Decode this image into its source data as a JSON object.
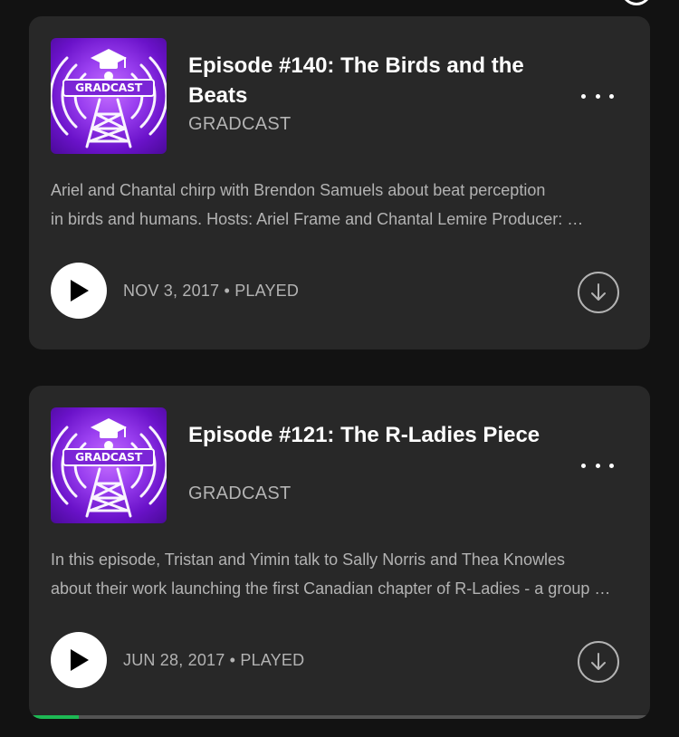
{
  "colors": {
    "background": "#121212",
    "card": "#282828",
    "accent": "#1db954",
    "secondary_text": "#b3b3b3",
    "artwork_purple": "#9a3ff0"
  },
  "episodes": [
    {
      "title": "Episode #140: The Birds and the Beats",
      "show": "GRADCAST",
      "artwork_text": "GRADCAST",
      "description_lines": [
        "Ariel and Chantal chirp with Brendon Samuels about beat perception",
        "in birds and humans. Hosts: Ariel Frame and Chantal Lemire  Producer: …"
      ],
      "date": "NOV 3, 2017",
      "separator": "•",
      "status": "PLAYED",
      "icons": {
        "play": "play-icon",
        "more": "more-icon",
        "download": "download-icon"
      }
    },
    {
      "title": "Episode #121: The R-Ladies Piece",
      "show": "GRADCAST",
      "artwork_text": "GRADCAST",
      "description_lines": [
        "In this episode, Tristan and Yimin talk to Sally Norris and Thea Knowles",
        "about their work launching the first Canadian chapter of R-Ladies - a group …"
      ],
      "date": "JUN 28, 2017",
      "separator": "•",
      "status": "PLAYED",
      "progress_fraction": 0.08,
      "icons": {
        "play": "play-icon",
        "more": "more-icon",
        "download": "download-icon"
      }
    }
  ]
}
